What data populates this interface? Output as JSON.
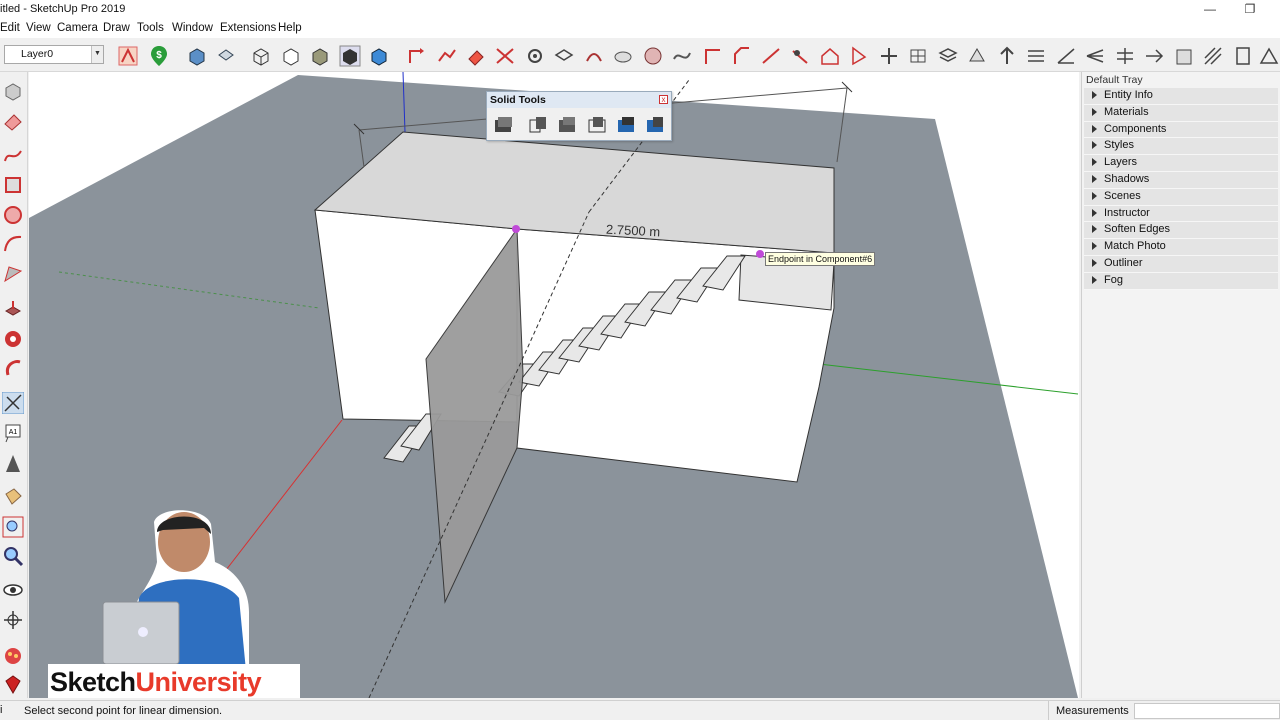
{
  "window": {
    "title": "itled - SketchUp Pro 2019",
    "minimize": "—",
    "restore": "❐"
  },
  "menu": [
    "Edit",
    "View",
    "Camera",
    "Draw",
    "Tools",
    "Window",
    "Extensions",
    "Help"
  ],
  "toolbar": {
    "layer_select_value": "Layer0"
  },
  "solid_tools": {
    "title": "Solid Tools",
    "close": "x"
  },
  "viewport": {
    "dimension_label": "2.7500 m",
    "inference_tooltip": "Endpoint in Component#6"
  },
  "tray": {
    "title": "Default Tray",
    "items": [
      "Entity Info",
      "Materials",
      "Components",
      "Styles",
      "Layers",
      "Shadows",
      "Scenes",
      "Instructor",
      "Soften Edges",
      "Match Photo",
      "Outliner",
      "Fog"
    ]
  },
  "status": {
    "icon": "i",
    "message": "Select second point for linear dimension.",
    "measurements_label": "Measurements"
  },
  "watermark": {
    "part1": "Sketch",
    "part2": "University"
  },
  "colors": {
    "ground": "#8b939b",
    "selection_point": "#c04ad8",
    "axis_red": "#d83030",
    "axis_green": "#2ca02c",
    "axis_blue": "#2030c8",
    "accent_red": "#e83a2a"
  }
}
